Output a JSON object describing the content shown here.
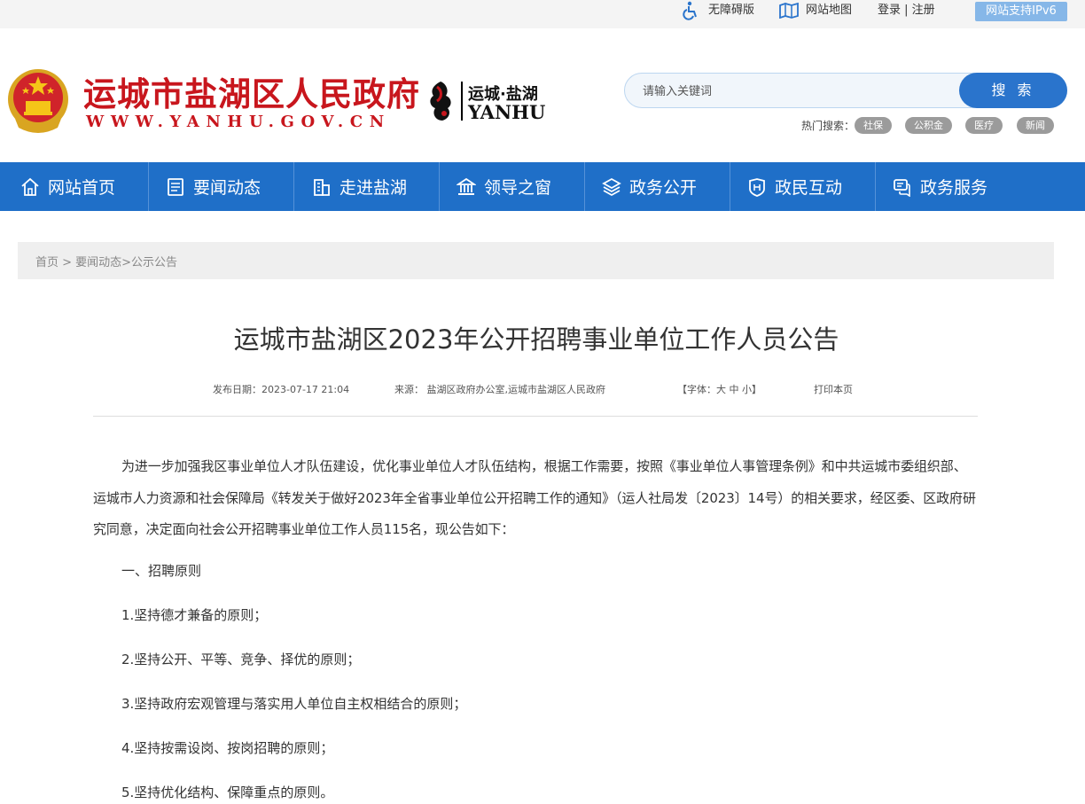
{
  "topbar": {
    "accessibility": "无障碍版",
    "sitemap": "网站地图",
    "login": "登录 | 注册",
    "ipv6": "网站支持IPv6"
  },
  "header": {
    "site_name": "运城市盐湖区人民政府",
    "site_url": "WWW.YANHU.GOV.CN",
    "logo_cn": "运城·盐湖",
    "logo_en": "YANHU",
    "search_placeholder": "请输入关键词",
    "search_button": "搜 索",
    "hot_label": "热门搜索：",
    "hot_tags": [
      "社保",
      "公积金",
      "医疗",
      "新闻"
    ]
  },
  "nav": [
    {
      "label": "网站首页",
      "icon": "home-icon"
    },
    {
      "label": "要闻动态",
      "icon": "news-icon"
    },
    {
      "label": "走进盐湖",
      "icon": "building-icon"
    },
    {
      "label": "领导之窗",
      "icon": "government-icon"
    },
    {
      "label": "政务公开",
      "icon": "layers-icon"
    },
    {
      "label": "政民互动",
      "icon": "shield-icon"
    },
    {
      "label": "政务服务",
      "icon": "chat-icon"
    }
  ],
  "breadcrumb": "首页 > 要闻动态>公示公告",
  "article": {
    "title": "运城市盐湖区2023年公开招聘事业单位工作人员公告",
    "date": "发布日期：2023-07-17 21:04",
    "source": "来源：  盐湖区政府办公室,运城市盐湖区人民政府",
    "font_size": "【字体：大  中  小】",
    "print": "打印本页",
    "intro": "为进一步加强我区事业单位人才队伍建设，优化事业单位人才队伍结构，根据工作需要，按照《事业单位人事管理条例》和中共运城市委组织部、运城市人力资源和社会保障局《转发关于做好2023年全省事业单位公开招聘工作的通知》（运人社局发〔2023〕14号）的相关要求，经区委、区政府研究同意，决定面向社会公开招聘事业单位工作人员115名，现公告如下：",
    "section1": "一、招聘原则",
    "items": [
      "1.坚持德才兼备的原则；",
      "2.坚持公开、平等、竞争、择优的原则；",
      "3.坚持政府宏观管理与落实用人单位自主权相结合的原则；",
      "4.坚持按需设岗、按岗招聘的原则；",
      "5.坚持优化结构、保障重点的原则。"
    ]
  },
  "colors": {
    "brand_red": "#c8161d",
    "nav_blue": "#1f6fc8",
    "search_blue": "#2a74cc"
  }
}
